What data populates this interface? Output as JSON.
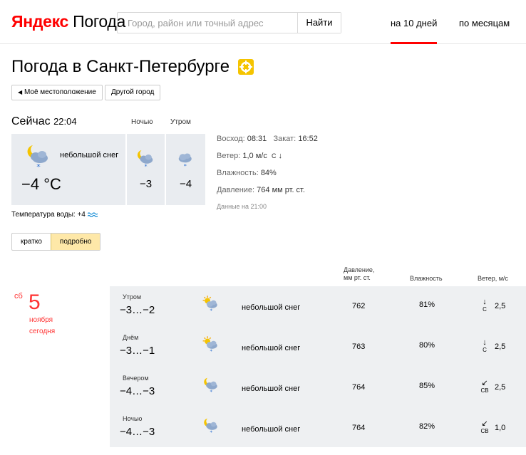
{
  "header": {
    "logo_brand": "Яндекс",
    "logo_product": "Погода",
    "search_placeholder": "Город, район или точный адрес",
    "search_button": "Найти",
    "tabs": [
      {
        "label": "на 10 дней",
        "active": true
      },
      {
        "label": "по месяцам",
        "active": false
      }
    ]
  },
  "page": {
    "title": "Погода в Санкт-Петербурге",
    "my_location": "Моё местоположение",
    "other_city": "Другой город"
  },
  "now": {
    "label": "Сейчас",
    "time": "22:04",
    "condition": "небольшой снег",
    "temp": "−4 °C",
    "night_label": "Ночью",
    "night_temp": "−3",
    "morning_label": "Утром",
    "morning_temp": "−4",
    "sunrise_label": "Восход:",
    "sunrise": "08:31",
    "sunset_label": "Закат:",
    "sunset": "16:52",
    "wind_label": "Ветер:",
    "wind": "1,0 м/с",
    "wind_dir": "С",
    "humidity_label": "Влажность:",
    "humidity": "84%",
    "pressure_label": "Давление:",
    "pressure": "764 мм рт. ст.",
    "data_time": "Данные на 21:00",
    "water_label": "Температура воды:",
    "water_temp": "+4"
  },
  "toggle": {
    "short": "кратко",
    "detailed": "подробно",
    "selected": "подробно"
  },
  "forecast": {
    "columns": {
      "pressure_1": "Давление,",
      "pressure_2": "мм рт. ст.",
      "humidity": "Влажность",
      "wind": "Ветер, м/с"
    },
    "day": {
      "dow": "сб",
      "number": "5",
      "month": "ноября",
      "today": "сегодня"
    },
    "rows": [
      {
        "period": "Утром",
        "temp": "−3…−2",
        "icon": "sun-cloud-snow-icon",
        "condition": "небольшой снег",
        "pressure": "762",
        "humidity": "81%",
        "wind_arrow": "↓",
        "wind_dir": "С",
        "wind_speed": "2,5"
      },
      {
        "period": "Днём",
        "temp": "−3…−1",
        "icon": "sun-cloud-snow-icon",
        "condition": "небольшой снег",
        "pressure": "763",
        "humidity": "80%",
        "wind_arrow": "↓",
        "wind_dir": "С",
        "wind_speed": "2,5"
      },
      {
        "period": "Вечером",
        "temp": "−4…−3",
        "icon": "moon-cloud-snow-icon",
        "condition": "небольшой снег",
        "pressure": "764",
        "humidity": "85%",
        "wind_arrow": "↙",
        "wind_dir": "СВ",
        "wind_speed": "2,5"
      },
      {
        "period": "Ночью",
        "temp": "−4…−3",
        "icon": "moon-cloud-snow-icon",
        "condition": "небольшой снег",
        "pressure": "764",
        "humidity": "82%",
        "wind_arrow": "↙",
        "wind_dir": "СВ",
        "wind_speed": "1,0"
      }
    ]
  }
}
